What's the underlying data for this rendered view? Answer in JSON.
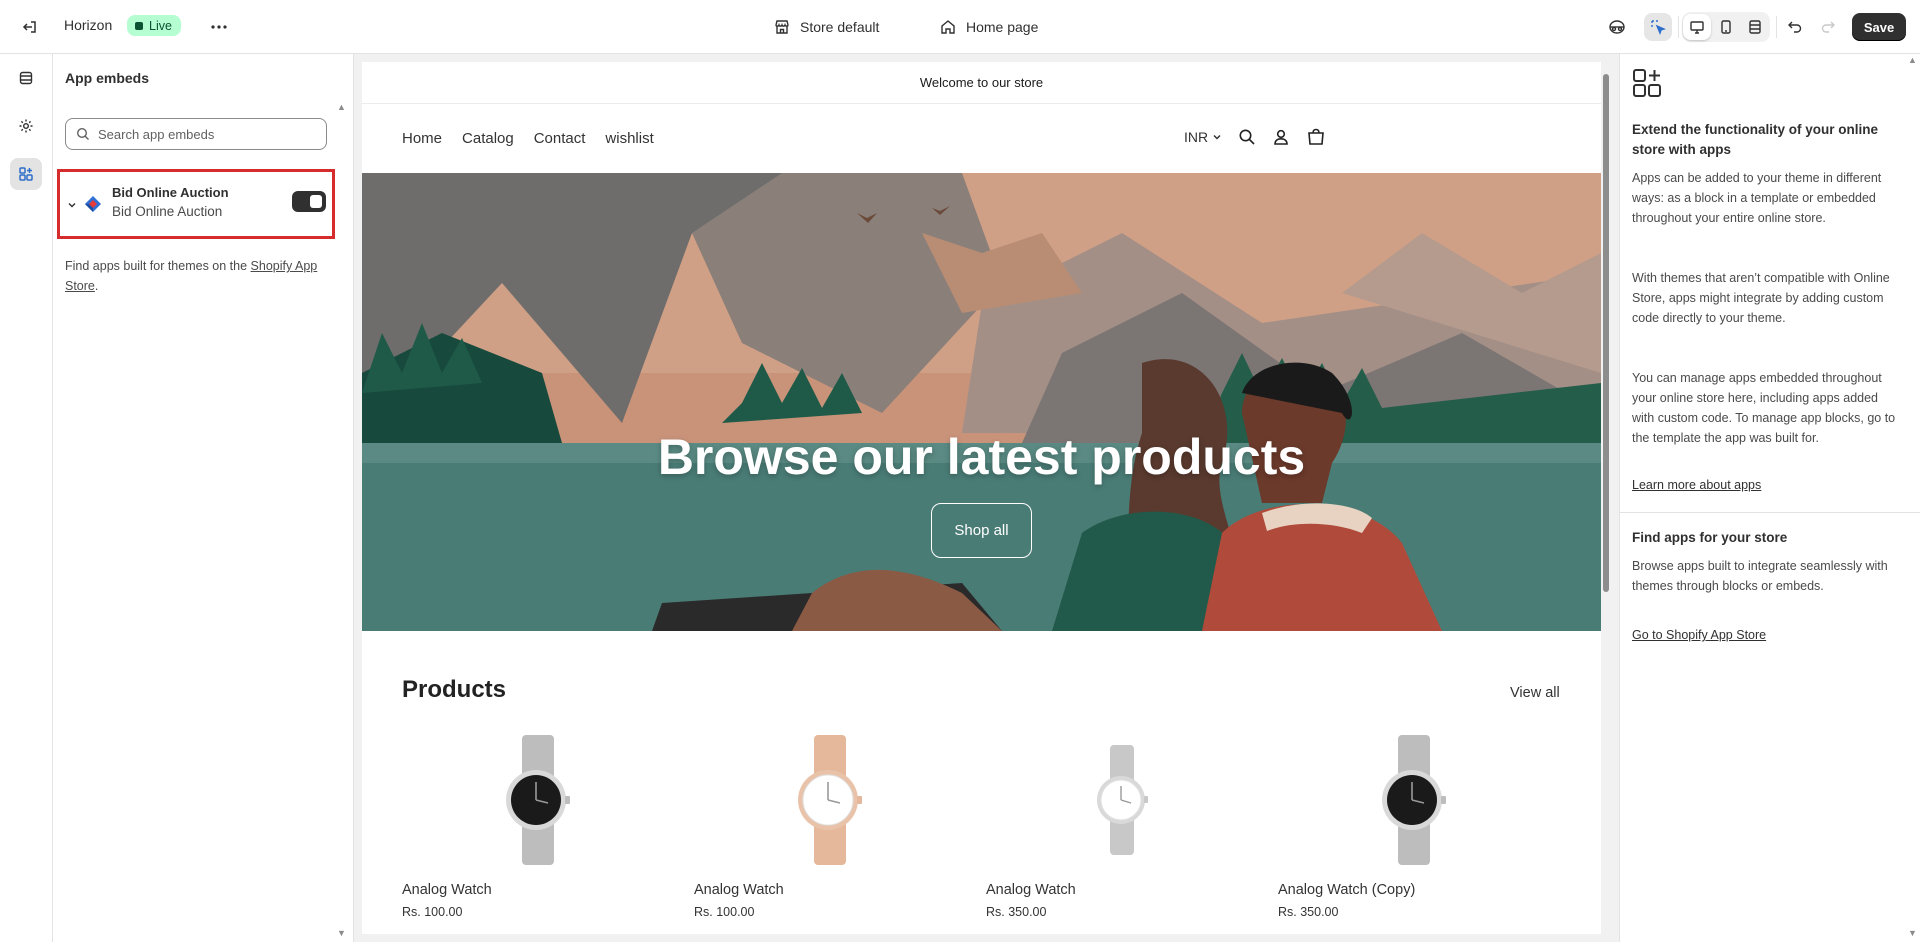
{
  "topbar": {
    "theme_name": "Horizon",
    "live_label": "Live",
    "store_label": "Store default",
    "page_label": "Home page",
    "save_label": "Save"
  },
  "sidebar": {
    "title": "App embeds",
    "search_placeholder": "Search app embeds",
    "app": {
      "name": "Bid Online Auction",
      "subtitle": "Bid Online Auction",
      "enabled": true
    },
    "find_text": "Find apps built for themes on the ",
    "find_link": "Shopify App Store",
    "find_end": "."
  },
  "preview": {
    "announcement": "Welcome to our store",
    "nav": [
      "Home",
      "Catalog",
      "Contact",
      "wishlist"
    ],
    "currency": "INR",
    "hero_title": "Browse our latest products",
    "hero_button": "Shop all",
    "products_title": "Products",
    "view_all": "View all",
    "products": [
      {
        "name": "Analog Watch",
        "price": "Rs. 100.00",
        "dial": "#1a1a1a",
        "band": "#bdbdbd"
      },
      {
        "name": "Analog Watch",
        "price": "Rs. 100.00",
        "dial": "#ffffff",
        "band": "#e6b89b"
      },
      {
        "name": "Analog Watch",
        "price": "Rs. 350.00",
        "dial": "#ffffff",
        "band": "#c8c8c8"
      },
      {
        "name": "Analog Watch (Copy)",
        "price": "Rs. 350.00",
        "dial": "#1a1a1a",
        "band": "#bdbdbd"
      }
    ]
  },
  "right_panel": {
    "heading1": "Extend the functionality of your online store with apps",
    "p1": "Apps can be added to your theme in different ways: as a block in a template or embedded throughout your entire online store.",
    "p2": "With themes that aren’t compatible with Online Store, apps might integrate by adding custom code directly to your theme.",
    "p3": "You can manage apps embedded throughout your online store here, including apps added with custom code. To manage app blocks, go to the template the app was built for.",
    "link1": "Learn more about apps",
    "heading2": "Find apps for your store",
    "p4": "Browse apps built to integrate seamlessly with themes through blocks or embeds.",
    "link2": "Go to Shopify App Store"
  }
}
